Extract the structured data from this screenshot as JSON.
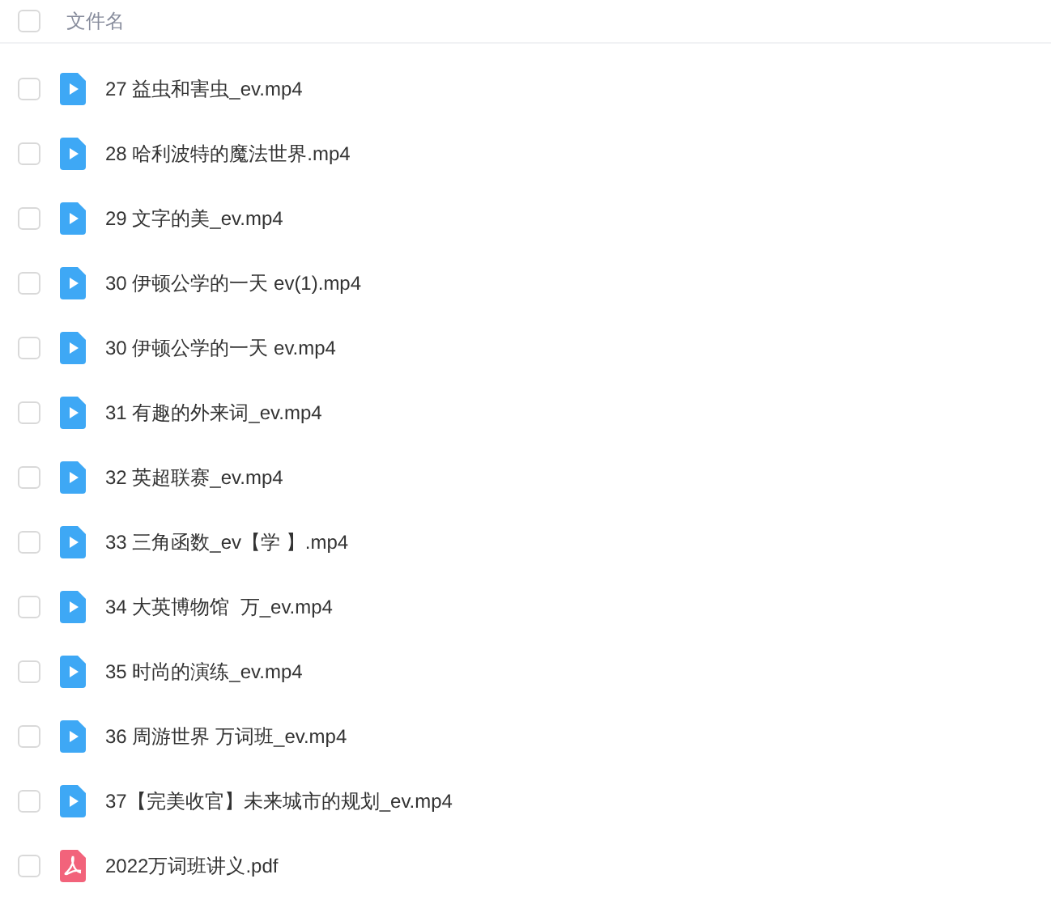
{
  "header": {
    "label": "文件名",
    "checked": false
  },
  "files": [
    {
      "name": "27 益虫和害虫_ev.mp4",
      "kind": "video",
      "checked": false
    },
    {
      "name": "28 哈利波特的魔法世界.mp4",
      "kind": "video",
      "checked": false
    },
    {
      "name": "29 文字的美_ev.mp4",
      "kind": "video",
      "checked": false
    },
    {
      "name": "30 伊顿公学的一天 ev(1).mp4",
      "kind": "video",
      "checked": false
    },
    {
      "name": "30 伊顿公学的一天 ev.mp4",
      "kind": "video",
      "checked": false
    },
    {
      "name": "31 有趣的外来词_ev.mp4",
      "kind": "video",
      "checked": false
    },
    {
      "name": "32 英超联赛_ev.mp4",
      "kind": "video",
      "checked": false
    },
    {
      "name": "33 三角函数_ev【学 】.mp4",
      "kind": "video",
      "checked": false
    },
    {
      "name": "34 大英博物馆  万_ev.mp4",
      "kind": "video",
      "checked": false
    },
    {
      "name": "35 时尚的演练_ev.mp4",
      "kind": "video",
      "checked": false
    },
    {
      "name": "36 周游世界 万词班_ev.mp4",
      "kind": "video",
      "checked": false
    },
    {
      "name": "37【完美收官】未来城市的规划_ev.mp4",
      "kind": "video",
      "checked": false
    },
    {
      "name": "2022万词班讲义.pdf",
      "kind": "pdf",
      "checked": false
    }
  ]
}
